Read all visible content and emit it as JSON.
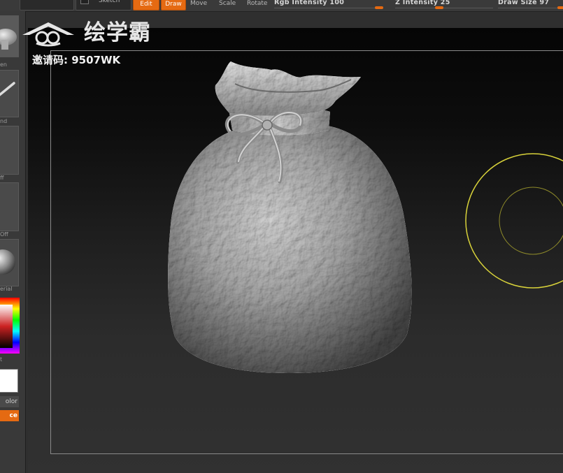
{
  "toolbar": {
    "sketch_label": "Sketch",
    "edit_label": "Edit",
    "draw_label": "Draw",
    "move_label": "Move",
    "scale_label": "Scale",
    "rotate_label": "Rotate",
    "rgb_intensity_label": "Rgb Intensity 100",
    "z_intensity_label": "Z Intensity 25",
    "draw_size_label": "Draw Size 97",
    "rgb_intensity": 100,
    "z_intensity": 25,
    "draw_size": 97
  },
  "left_panel": {
    "brush_label": "en",
    "stroke_label": "nd",
    "alpha_label": "ff",
    "texture_label": "Off",
    "material_label": "erial",
    "gradient_label": "t",
    "switch_color_label": "olor",
    "alternate_label": "ce"
  },
  "watermark": {
    "brand": "绘学霸",
    "invite": "邀请码: 9507WK"
  },
  "colors": {
    "accent": "#e56a12",
    "cursor": "#d8d23a"
  }
}
